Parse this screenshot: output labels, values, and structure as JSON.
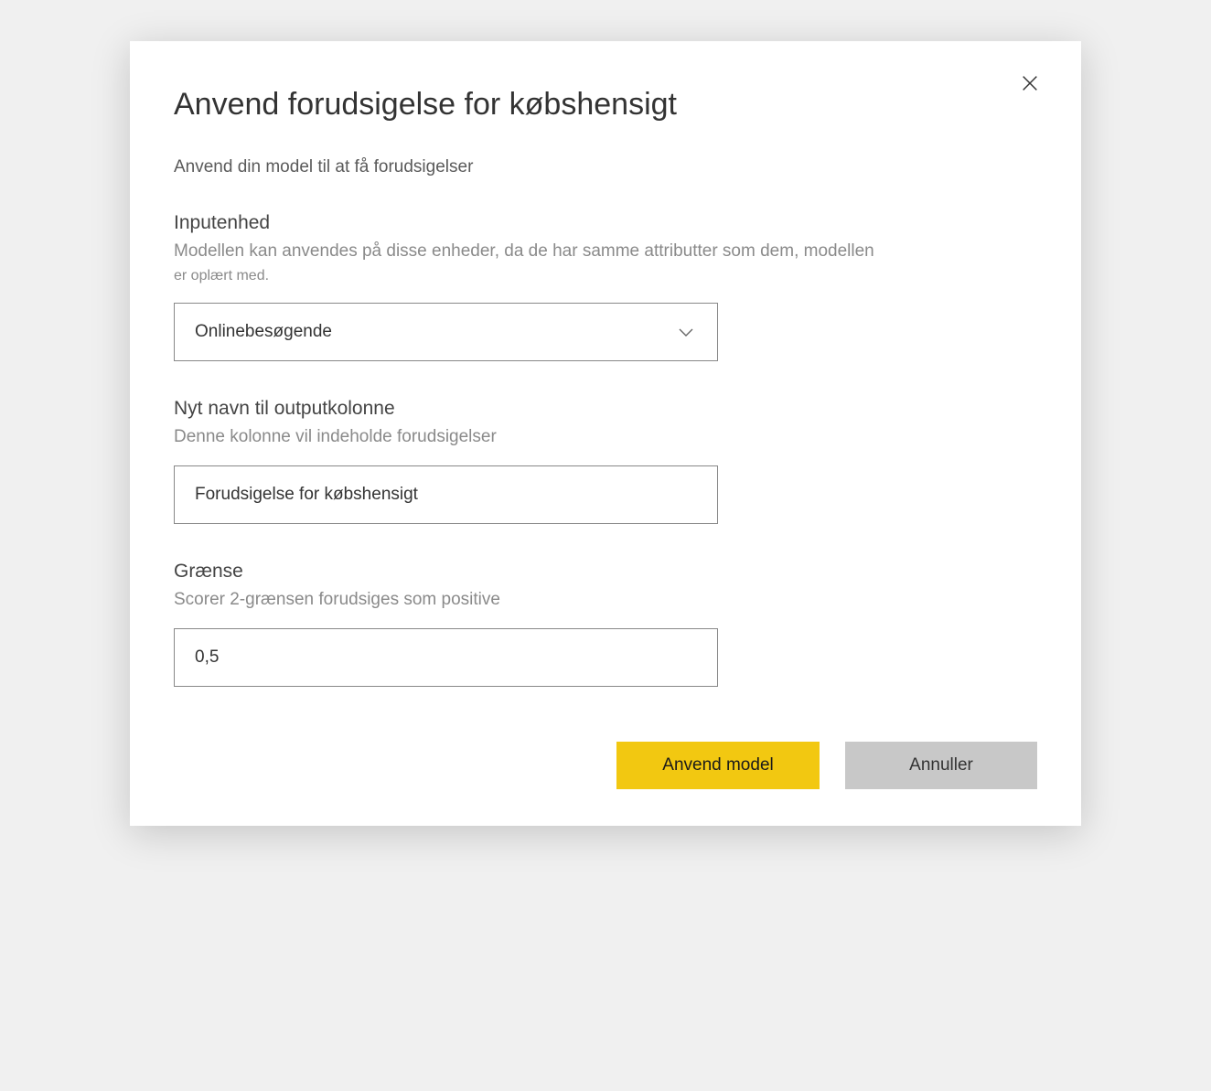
{
  "dialog": {
    "title": "Anvend forudsigelse for købshensigt",
    "subtitle": "Anvend din model til at få forudsigelser"
  },
  "inputEntity": {
    "label": "Inputenhed",
    "description": "Modellen kan anvendes på disse enheder, da de har samme attributter som dem, modellen",
    "descriptionLine2": "er oplært med.",
    "selected": "Onlinebesøgende"
  },
  "outputColumn": {
    "label": "Nyt navn til outputkolonne",
    "description": "Denne kolonne vil indeholde forudsigelser",
    "value": "Forudsigelse for købshensigt"
  },
  "threshold": {
    "label": "Grænse",
    "description": "Scorer 2-grænsen forudsiges som positive",
    "value": "0,5"
  },
  "buttons": {
    "apply": "Anvend model",
    "cancel": "Annuller"
  }
}
